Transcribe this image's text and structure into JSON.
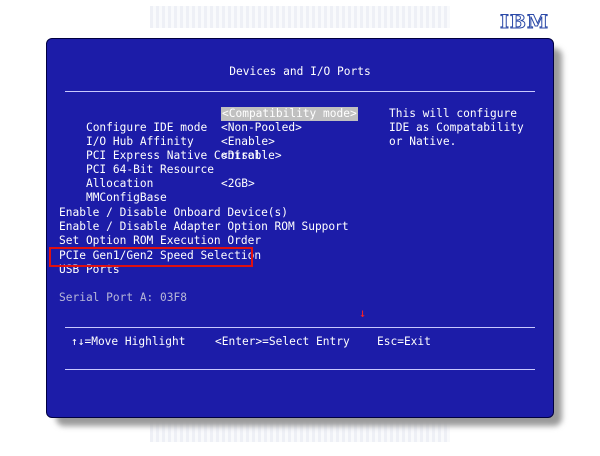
{
  "brand": "IBM",
  "window": {
    "title": "Devices and I/O Ports"
  },
  "settings": [
    {
      "label": "Configure IDE mode",
      "value": "<Compatibility mode>",
      "selected": true
    },
    {
      "label": "I/O Hub Affinity",
      "value": "<Non-Pooled>"
    },
    {
      "label": "PCI Express Native Control",
      "value": "<Enable>"
    },
    {
      "label": "PCI 64-Bit Resource",
      "value": "<Disable>"
    },
    {
      "label": "Allocation",
      "value": ""
    },
    {
      "label": "MMConfigBase",
      "value": "<2GB>"
    }
  ],
  "help": [
    "This will configure",
    "IDE as Compatability",
    "or Native."
  ],
  "submenus": [
    "Enable / Disable Onboard Device(s)",
    "Enable / Disable Adapter Option ROM Support",
    "Set Option ROM Execution Order",
    "PCIe Gen1/Gen2 Speed Selection",
    "USB Ports"
  ],
  "serial_port": "Serial Port A: 03F8",
  "scroll_indicator": "↓",
  "footer": {
    "move": "↑↓=Move Highlight",
    "select": "<Enter>=Select Entry",
    "exit": "Esc=Exit"
  },
  "colors": {
    "background": "#1c1ca8",
    "text": "#ffffff",
    "highlight_border": "#e01010"
  }
}
